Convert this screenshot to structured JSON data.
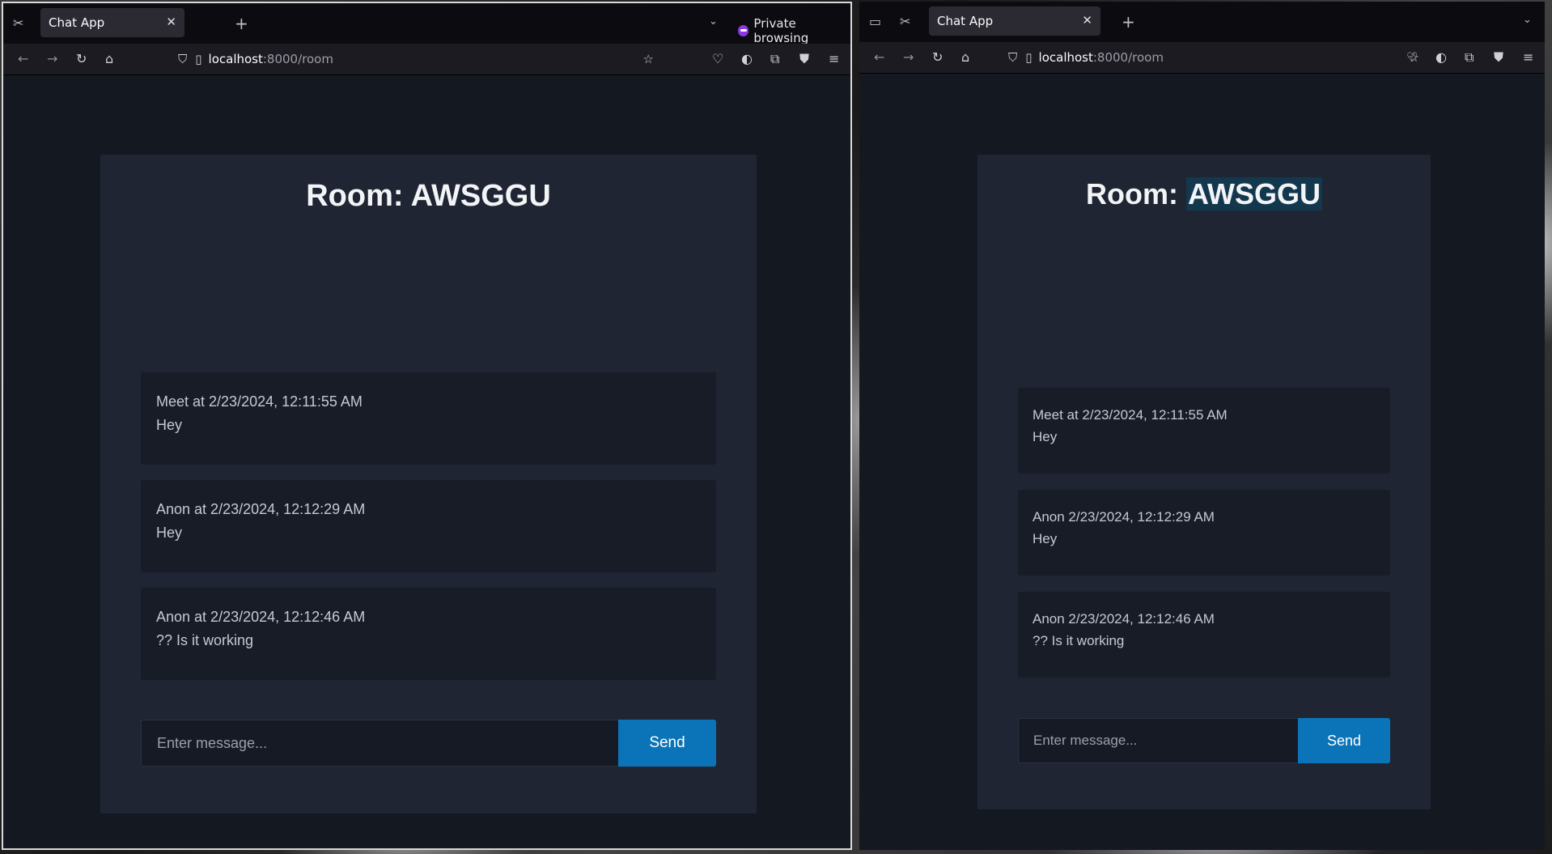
{
  "left_window": {
    "tab_title": "Chat App",
    "private_label": "Private browsing",
    "url_host": "localhost",
    "url_rest": ":8000/room",
    "room_label": "Room: ",
    "room_id": "AWSGGU",
    "messages": [
      {
        "meta": "Meet at 2/23/2024, 12:11:55 AM",
        "text": "Hey"
      },
      {
        "meta": "Anon at 2/23/2024, 12:12:29 AM",
        "text": "Hey"
      },
      {
        "meta": "Anon at 2/23/2024, 12:12:46 AM",
        "text": "?? Is it working"
      }
    ],
    "input_placeholder": "Enter message...",
    "send_label": "Send"
  },
  "right_window": {
    "tab_title": "Chat App",
    "url_host": "localhost",
    "url_rest": ":8000/room",
    "room_label": "Room: ",
    "room_id": "AWSGGU",
    "messages": [
      {
        "meta": "Meet at 2/23/2024, 12:11:55 AM",
        "text": "Hey"
      },
      {
        "meta": "Anon 2/23/2024, 12:12:29 AM",
        "text": "Hey"
      },
      {
        "meta": "Anon 2/23/2024, 12:12:46 AM",
        "text": "?? Is it working"
      }
    ],
    "input_placeholder": "Enter message...",
    "send_label": "Send"
  },
  "icons": {
    "back": "arrow-left-icon",
    "forward": "arrow-right-icon",
    "reload": "reload-icon",
    "home": "home-icon",
    "bookmark": "star-icon",
    "menu": "hamburger-menu-icon"
  }
}
